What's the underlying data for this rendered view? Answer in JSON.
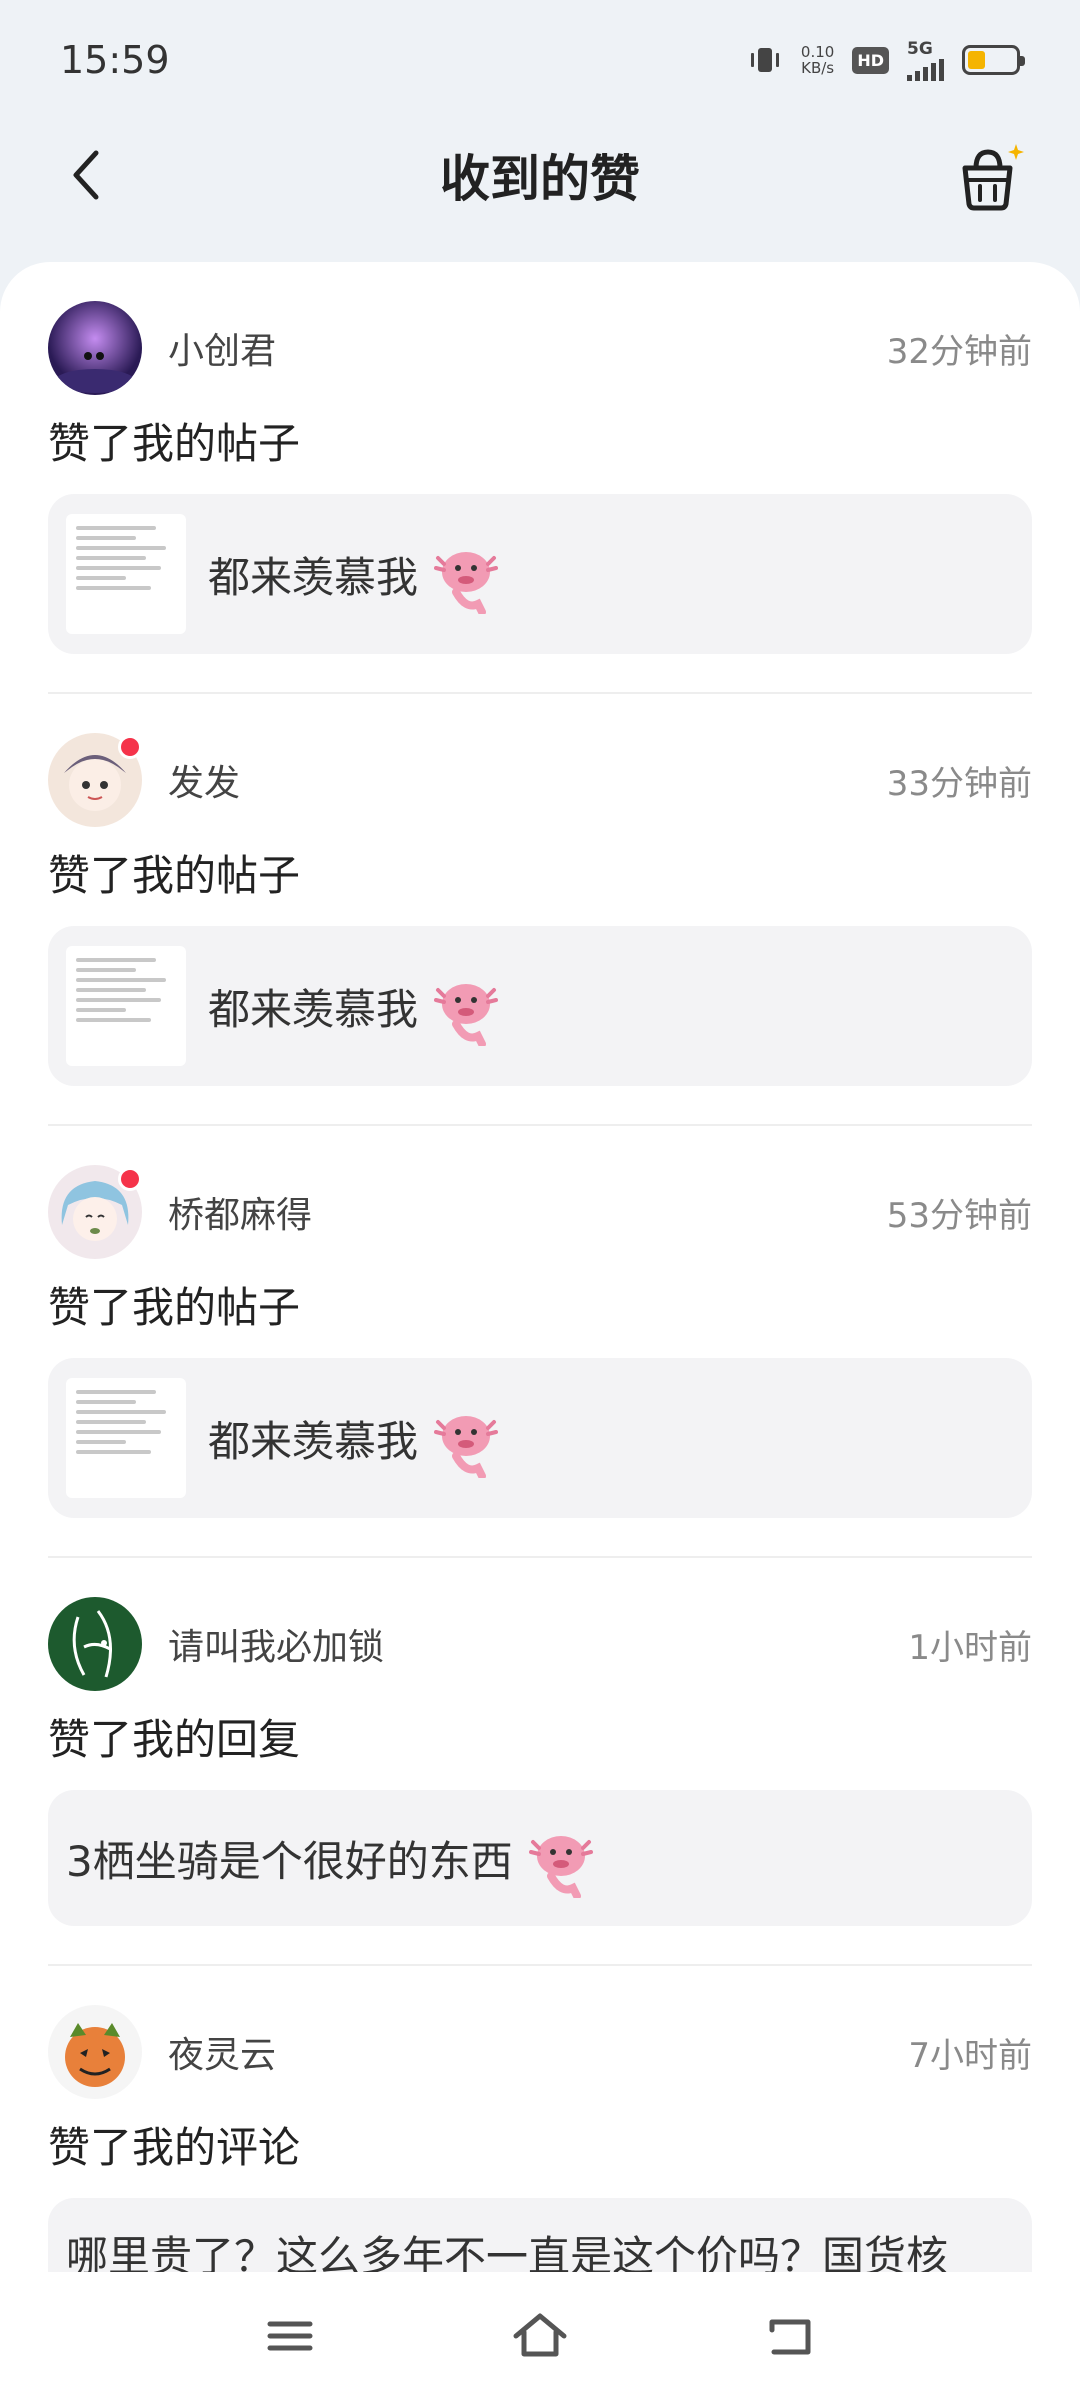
{
  "status": {
    "time": "15:59",
    "speed_value": "0.10",
    "speed_unit": "KB/s",
    "hd": "HD",
    "network": "5G"
  },
  "header": {
    "title": "收到的赞"
  },
  "items": [
    {
      "user": "小创君",
      "time": "32分钟前",
      "action": "赞了我的帖子",
      "text": "都来羡慕我",
      "unread": false
    },
    {
      "user": "发发",
      "time": "33分钟前",
      "action": "赞了我的帖子",
      "text": "都来羡慕我",
      "unread": true
    },
    {
      "user": "桥都麻得",
      "time": "53分钟前",
      "action": "赞了我的帖子",
      "text": "都来羡慕我",
      "unread": true
    },
    {
      "user": "请叫我必加锁",
      "time": "1小时前",
      "action": "赞了我的回复",
      "text": "3栖坐骑是个很好的东西"
    },
    {
      "user": "夜灵云",
      "time": "7小时前",
      "action": "赞了我的评论",
      "text": "哪里贵了？这么多年不一直是这个价吗？国货核"
    }
  ]
}
